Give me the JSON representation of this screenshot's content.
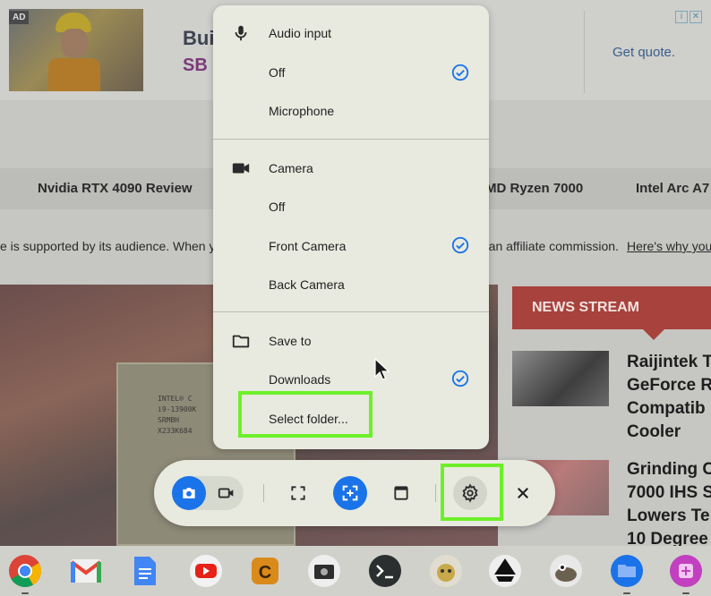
{
  "ad": {
    "tag": "AD",
    "title": "Buil",
    "logo": "SB",
    "cta": "Get quote.",
    "info_glyph": "i",
    "close_glyph": "✕"
  },
  "navbar": {
    "items": [
      "Nvidia RTX 4090 Review",
      "MD Ryzen 7000",
      "Intel Arc A7"
    ]
  },
  "disclaimer": {
    "part_a": "e is supported by its audience. When yo",
    "part_b": "n an affiliate commission.",
    "link": "Here's why you"
  },
  "hero": {
    "chip_text": "INTEL® C\ni9-13900K\nSRMBH\nX233K684"
  },
  "news": {
    "header": "NEWS STREAM",
    "item1": "Raijintek T\nGeForce R\nCompatib\nCooler",
    "item2": "Grinding C\n7000 IHS S\nLowers Te\n10 Degree"
  },
  "settings_menu": {
    "audio": {
      "title": "Audio input",
      "options": [
        {
          "label": "Off",
          "selected": true
        },
        {
          "label": "Microphone",
          "selected": false
        }
      ]
    },
    "camera": {
      "title": "Camera",
      "options": [
        {
          "label": "Off",
          "selected": false
        },
        {
          "label": "Front Camera",
          "selected": true
        },
        {
          "label": "Back Camera",
          "selected": false
        }
      ]
    },
    "save_to": {
      "title": "Save to",
      "options": [
        {
          "label": "Downloads",
          "selected": true
        },
        {
          "label": "Select folder...",
          "selected": false
        }
      ]
    }
  },
  "toolbar": {
    "buttons": [
      "screenshot-mode",
      "screen-record-mode",
      "fullscreen-capture",
      "partial-capture",
      "window-capture",
      "settings",
      "close"
    ],
    "active_mode": "screenshot-mode",
    "active_region": "partial-capture"
  },
  "shelf": {
    "apps": [
      "Chrome",
      "Gmail",
      "Docs",
      "YouTube",
      "C",
      "Camera",
      "Terminal",
      "App",
      "Inkscape",
      "GIMP",
      "Files",
      "App"
    ]
  },
  "colors": {
    "accent": "#1a73e8",
    "highlight": "#6df02a",
    "menu_bg": "#e8eadf",
    "news_red": "#a8423c"
  }
}
